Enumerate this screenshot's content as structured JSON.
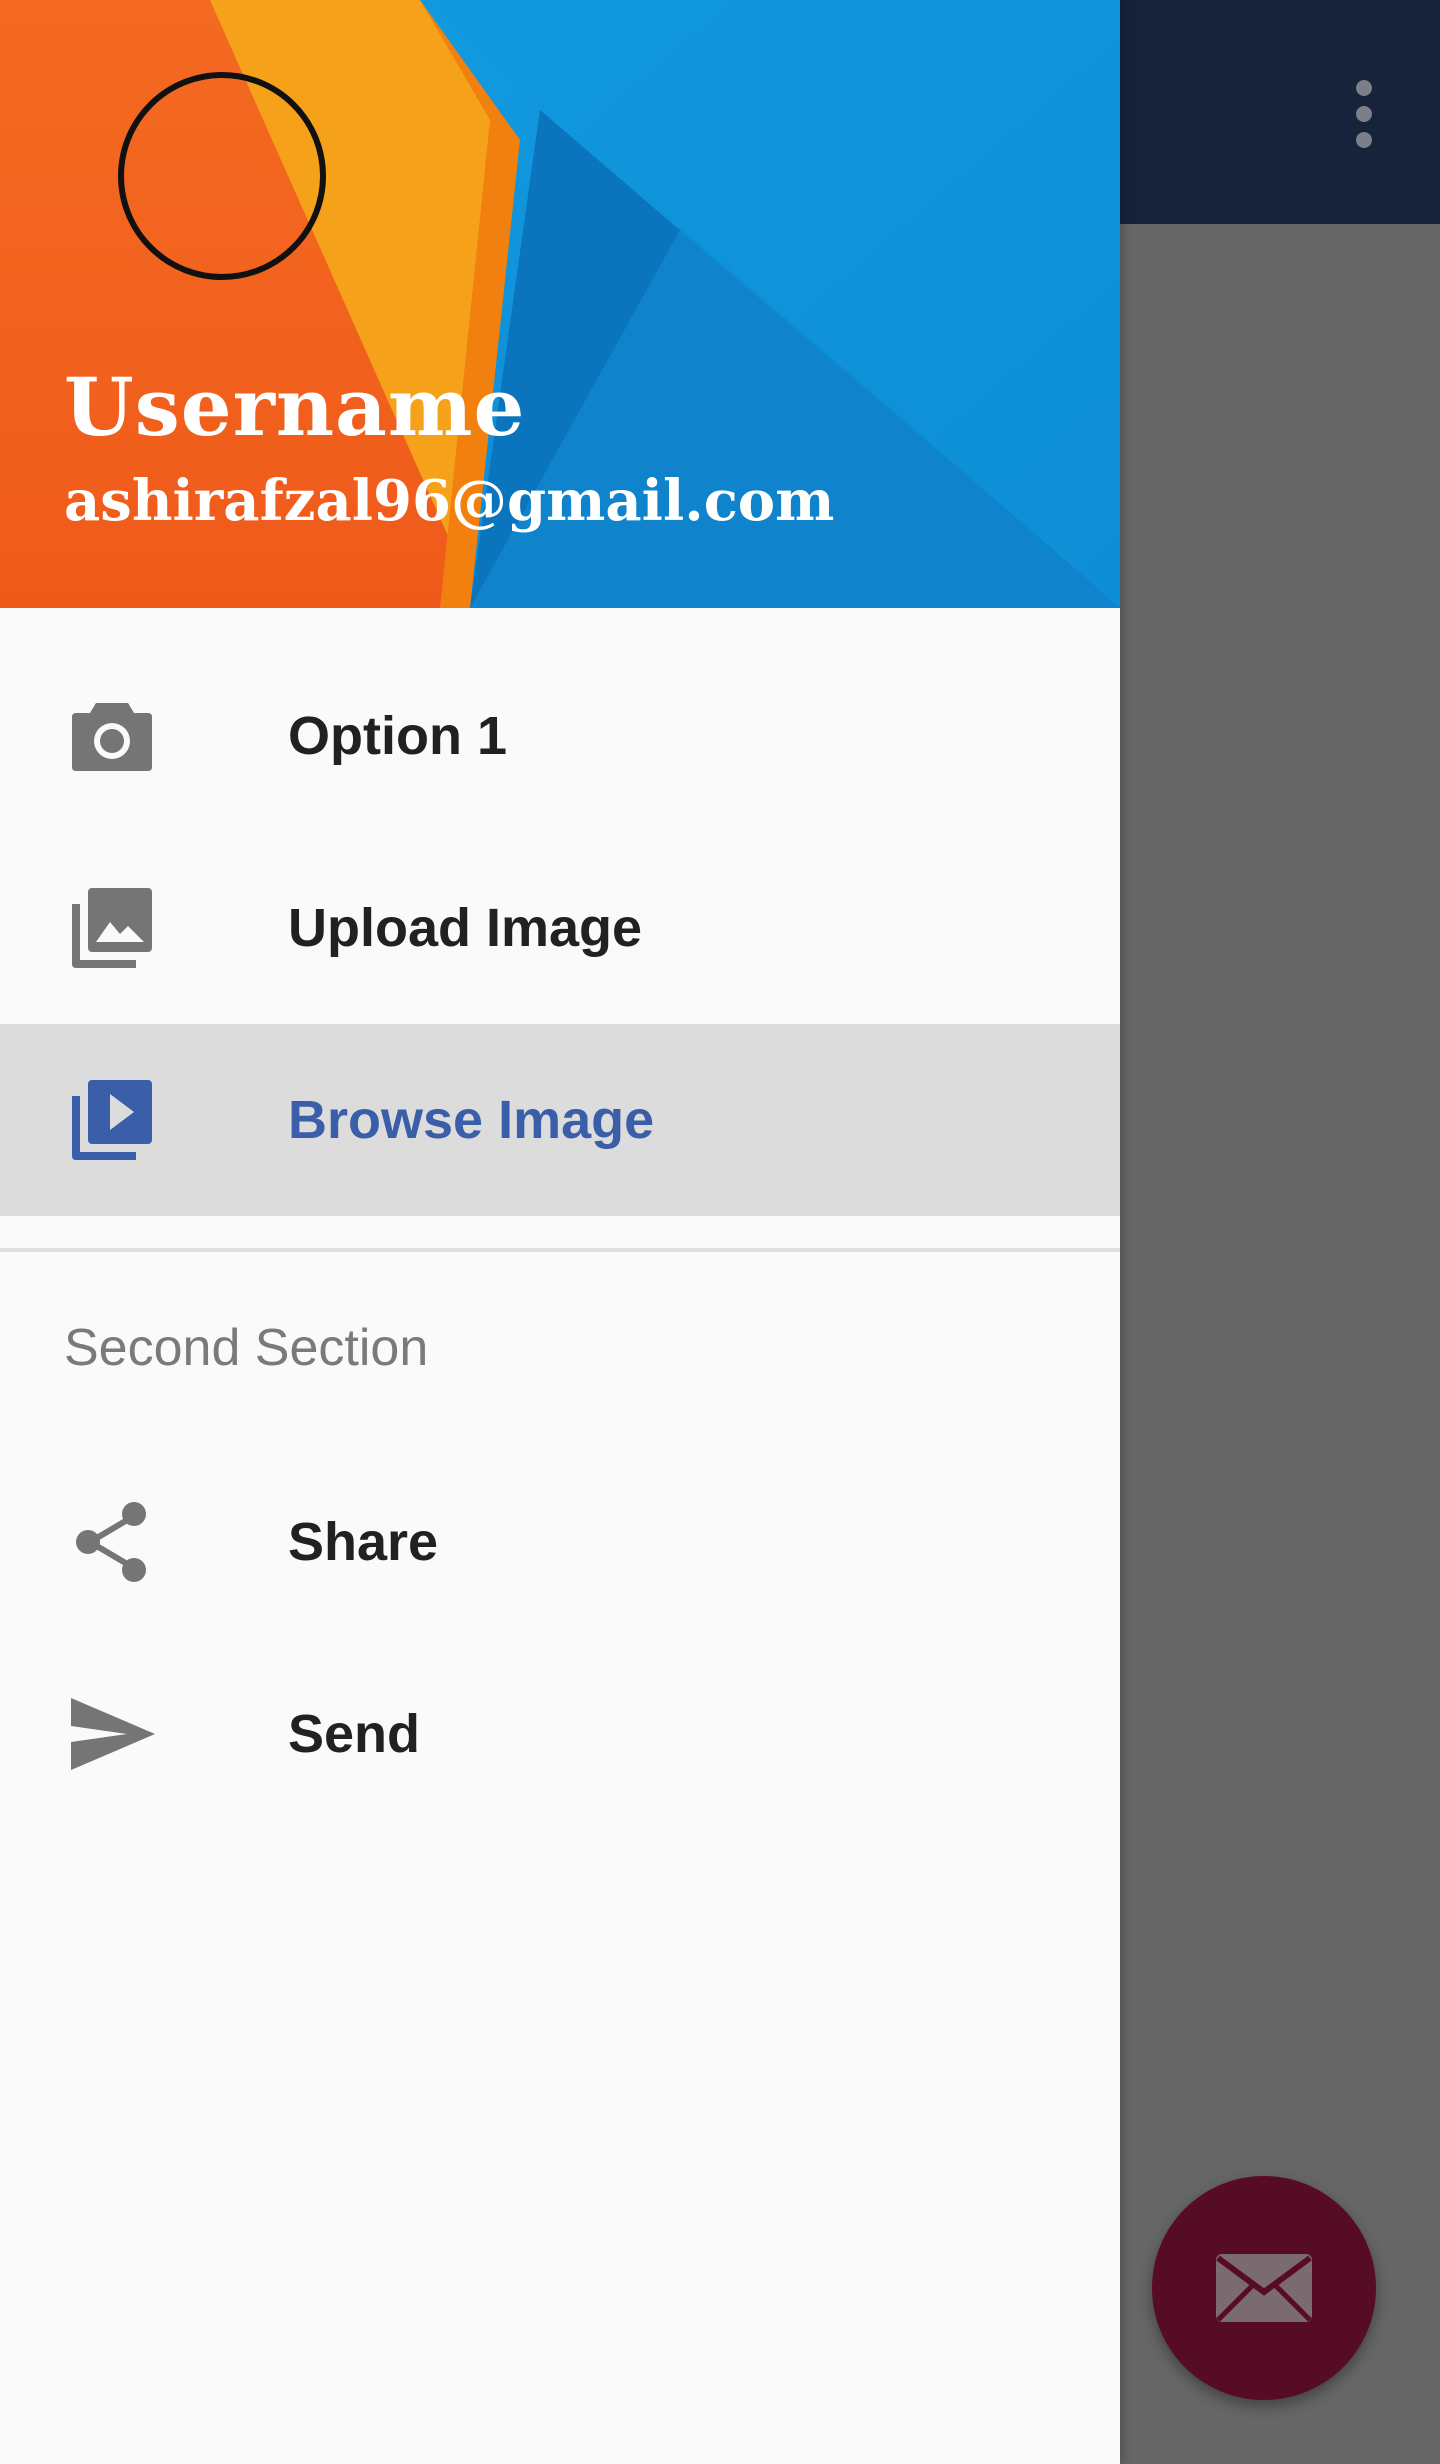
{
  "header": {
    "username": "Username",
    "email": "ashirafzal96@gmail.com"
  },
  "menu": {
    "items": [
      {
        "label": "Option 1",
        "icon": "camera-icon"
      },
      {
        "label": "Upload Image",
        "icon": "photo-library-icon"
      },
      {
        "label": "Browse Image",
        "icon": "video-library-icon",
        "selected": true
      }
    ]
  },
  "second_section": {
    "title": "Second Section",
    "items": [
      {
        "label": "Share",
        "icon": "share-icon"
      },
      {
        "label": "Send",
        "icon": "send-icon"
      }
    ]
  },
  "colors": {
    "app_bar": "#17223b",
    "selected_text": "#3b5ea8",
    "fab": "#560c24"
  }
}
